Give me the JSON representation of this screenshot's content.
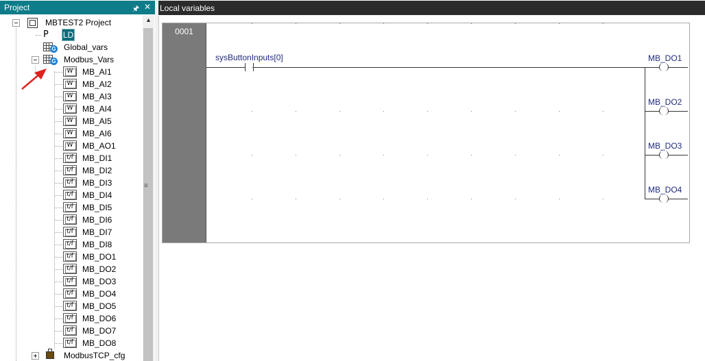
{
  "project_panel": {
    "title": "Project",
    "project_name": "MBTEST2 Project",
    "program_label": "P",
    "program_lang": "LD",
    "global_vars": "Global_vars",
    "modbus_vars": "Modbus_Vars",
    "variables": [
      {
        "name": "MB_AI1",
        "type_icon": "W"
      },
      {
        "name": "MB_AI2",
        "type_icon": "W"
      },
      {
        "name": "MB_AI3",
        "type_icon": "W"
      },
      {
        "name": "MB_AI4",
        "type_icon": "W"
      },
      {
        "name": "MB_AI5",
        "type_icon": "W"
      },
      {
        "name": "MB_AI6",
        "type_icon": "W"
      },
      {
        "name": "MB_AO1",
        "type_icon": "W"
      },
      {
        "name": "MB_DI1",
        "type_icon": "t/f"
      },
      {
        "name": "MB_DI2",
        "type_icon": "t/f"
      },
      {
        "name": "MB_DI3",
        "type_icon": "t/f"
      },
      {
        "name": "MB_DI4",
        "type_icon": "t/f"
      },
      {
        "name": "MB_DI5",
        "type_icon": "t/f"
      },
      {
        "name": "MB_DI6",
        "type_icon": "t/f"
      },
      {
        "name": "MB_DI7",
        "type_icon": "t/f"
      },
      {
        "name": "MB_DI8",
        "type_icon": "t/f"
      },
      {
        "name": "MB_DO1",
        "type_icon": "t/f"
      },
      {
        "name": "MB_DO2",
        "type_icon": "t/f"
      },
      {
        "name": "MB_DO3",
        "type_icon": "t/f"
      },
      {
        "name": "MB_DO4",
        "type_icon": "t/f"
      },
      {
        "name": "MB_DO5",
        "type_icon": "t/f"
      },
      {
        "name": "MB_DO6",
        "type_icon": "t/f"
      },
      {
        "name": "MB_DO7",
        "type_icon": "t/f"
      },
      {
        "name": "MB_DO8",
        "type_icon": "t/f"
      }
    ],
    "modbus_cfg": "ModbusTCP_cfg"
  },
  "editor": {
    "title": "Local variables",
    "rung_number": "0001",
    "contact_label": "sysButtonInputs[0]",
    "coils": [
      "MB_DO1",
      "MB_DO2",
      "MB_DO3",
      "MB_DO4"
    ]
  },
  "colors": {
    "panel_header": "#0e7d89",
    "editor_header": "#2b2b2b",
    "rung_bar": "#7a7a7a",
    "variable_text": "#1f2a7a",
    "annotation_arrow": "#e02020"
  }
}
